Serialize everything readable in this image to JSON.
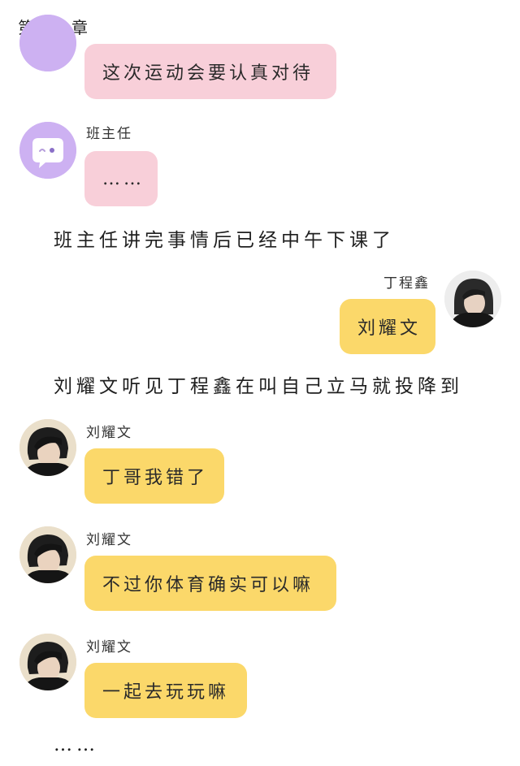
{
  "chapter": {
    "title": "第十九章"
  },
  "messages": [
    {
      "sender": "",
      "text": "这次运动会要认真对待"
    },
    {
      "sender": "班主任",
      "text": "……"
    },
    {
      "sender": "丁程鑫",
      "text": "刘耀文"
    },
    {
      "sender": "刘耀文",
      "text": "丁哥我错了"
    },
    {
      "sender": "刘耀文",
      "text": "不过你体育确实可以嘛"
    },
    {
      "sender": "刘耀文",
      "text": "一起去玩玩嘛"
    }
  ],
  "narration": {
    "line1": "班主任讲完事情后已经中午下课了",
    "line2": "刘耀文听见丁程鑫在叫自己立马就投降到",
    "ending": "……"
  },
  "colors": {
    "pink_bubble": "#f8cfd9",
    "yellow_bubble": "#fbd86a",
    "purple_avatar": "#cdb1f2"
  },
  "icons": {
    "teacher_avatar": "chat-bubble-face-icon",
    "student_avatar": "boy-portrait-avatar"
  }
}
